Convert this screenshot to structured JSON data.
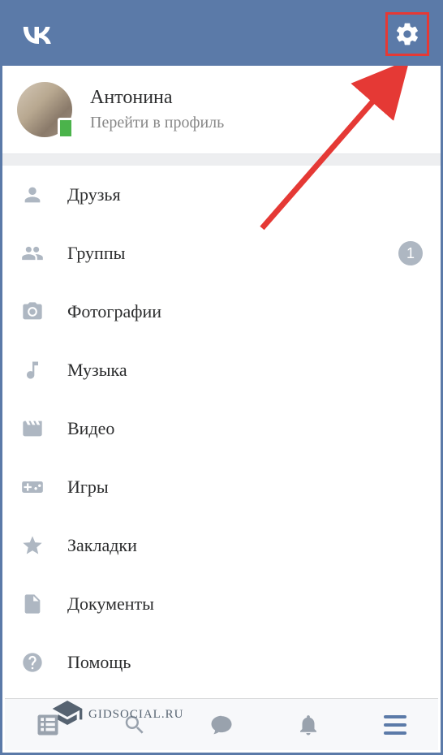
{
  "header": {
    "logo_text": "VK"
  },
  "profile": {
    "name": "Антонина",
    "subtitle": "Перейти в профиль"
  },
  "menu": {
    "friends": "Друзья",
    "groups": "Группы",
    "groups_badge": "1",
    "photos": "Фотографии",
    "music": "Музыка",
    "video": "Видео",
    "games": "Игры",
    "bookmarks": "Закладки",
    "documents": "Документы",
    "help": "Помощь"
  },
  "watermark": {
    "text": "GIDSOCIAL.RU"
  }
}
